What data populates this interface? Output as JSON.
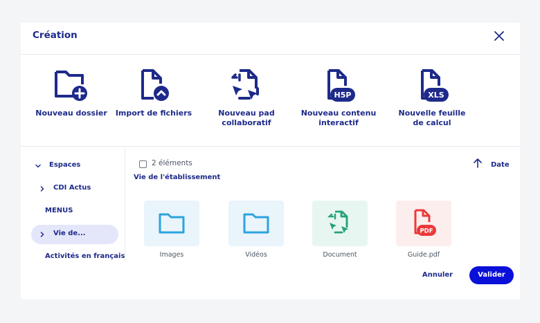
{
  "dialog": {
    "title": "Création"
  },
  "actions": [
    {
      "label": "Nouveau dossier",
      "icon": "folder-plus-icon"
    },
    {
      "label": "Import de fichiers",
      "icon": "file-upload-icon"
    },
    {
      "label": "Nouveau pad\ncollaboratif",
      "icon": "collaborative-pad-icon"
    },
    {
      "label": "Nouveau contenu\ninteractif",
      "icon": "h5p-file-icon"
    },
    {
      "label": "Nouvelle feuille\nde calcul",
      "icon": "xls-file-icon"
    }
  ],
  "sidebar": {
    "items": [
      {
        "label": "Espaces",
        "chevron": "down"
      },
      {
        "label": "CDI Actus",
        "chevron": "right"
      },
      {
        "label": "MENUS",
        "chevron": "none"
      },
      {
        "label": "Vie de...",
        "chevron": "right",
        "active": true
      },
      {
        "label": "Activités en français",
        "chevron": "none"
      }
    ]
  },
  "content": {
    "count_label": "2 éléments",
    "sort_label": "Date",
    "breadcrumb": "Vie de l'établissement",
    "tiles": [
      {
        "name": "Images",
        "type": "folder"
      },
      {
        "name": "Vidéos",
        "type": "folder"
      },
      {
        "name": "Document",
        "type": "collaborative-doc"
      },
      {
        "name": "Guide.pdf",
        "type": "pdf"
      }
    ]
  },
  "footer": {
    "cancel_label": "Annuler",
    "confirm_label": "Valider"
  },
  "colors": {
    "primary": "#1d2a8a",
    "accent_button": "#0a10d8",
    "folder_blue": "#2ba3df",
    "doc_green": "#23a27a",
    "pdf_red": "#ea3a3a",
    "active_item_bg": "#e4e6fa"
  }
}
